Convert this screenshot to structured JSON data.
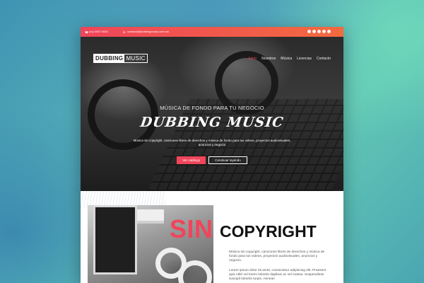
{
  "topbar": {
    "phone": "(xx) 0007 0000",
    "email": "contacto@dubbingmusic.com.mx",
    "socials": [
      "facebook-icon",
      "twitter-icon",
      "youtube-icon",
      "instagram-icon",
      "soundcloud-icon"
    ]
  },
  "logo": {
    "part1": "DUBBING",
    "part2": "MUSIC"
  },
  "nav": {
    "items": [
      {
        "label": "Inicio",
        "active": true
      },
      {
        "label": "Nosotros",
        "active": false
      },
      {
        "label": "Música",
        "active": false
      },
      {
        "label": "Licencias",
        "active": false
      },
      {
        "label": "Contacto",
        "active": false
      }
    ]
  },
  "hero": {
    "tagline": "MÚSICA DE FONDO PARA TU NEGOCIO",
    "title": "DUBBING MUSIC",
    "subtitle": "Música sin copyright, canciones libres de derechos y música de fondo para tus videos, proyectos audiovisuales, anuncios y negocio",
    "primary_button": "Ver catálogo",
    "secondary_button": "Continuar leyendo"
  },
  "section": {
    "heading_accent": "SIN",
    "heading_rest": "COPYRIGHT",
    "paragraph1": "Música sin copyright, canciones libres de derechos y música de fondo para tus videos, proyectos audiovisuales, anuncios y negocio.",
    "paragraph2": "Lorem ipsum dolor sit amet, consectetur adipiscing elit. Praesent quis nibh vel lorem lobortis dapibus ac vel massa. Suspendisse suscipit lobortis turpis. Aenean"
  },
  "colors": {
    "accent": "#f0455a",
    "accent2": "#f26a3f",
    "dark": "#1d1d1d"
  }
}
